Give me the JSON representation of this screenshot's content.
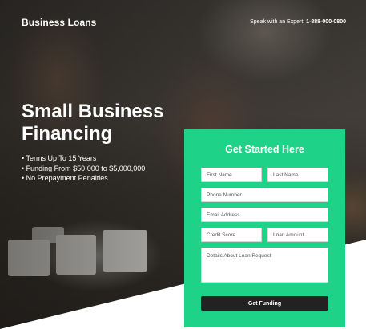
{
  "header": {
    "logo": "Business Loans",
    "expert_label": "Speak with an Expert:",
    "expert_phone": "1-888-000-0800"
  },
  "hero": {
    "headline": "Small Business Financing",
    "features": [
      "• Terms Up To 15 Years",
      "• Funding From $50,000 to $5,000,000",
      "• No Prepayment Penalties"
    ]
  },
  "form": {
    "title": "Get Started Here",
    "first_name_placeholder": "First Name",
    "last_name_placeholder": "Last Name",
    "phone_placeholder": "Phone Number",
    "email_placeholder": "Email Address",
    "credit_score_placeholder": "Credit Score",
    "loan_amount_placeholder": "Loan Amount",
    "details_placeholder": "Details About Loan Request",
    "submit_label": "Get Funding"
  },
  "colors": {
    "accent": "#1ed387",
    "button": "#222222"
  }
}
